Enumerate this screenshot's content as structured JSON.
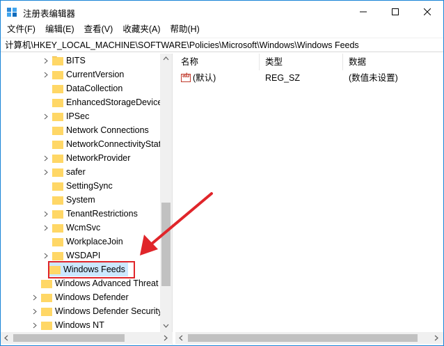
{
  "window": {
    "title": "注册表编辑器"
  },
  "menu": [
    {
      "label": "文件(F)"
    },
    {
      "label": "编辑(E)"
    },
    {
      "label": "查看(V)"
    },
    {
      "label": "收藏夹(A)"
    },
    {
      "label": "帮助(H)"
    }
  ],
  "address": {
    "path": "计算机\\HKEY_LOCAL_MACHINE\\SOFTWARE\\Policies\\Microsoft\\Windows\\Windows Feeds"
  },
  "tree": {
    "items": [
      {
        "label": "BITS",
        "expandable": true
      },
      {
        "label": "CurrentVersion",
        "expandable": true
      },
      {
        "label": "DataCollection",
        "expandable": false
      },
      {
        "label": "EnhancedStorageDevices",
        "expandable": false
      },
      {
        "label": "IPSec",
        "expandable": true
      },
      {
        "label": "Network Connections",
        "expandable": false
      },
      {
        "label": "NetworkConnectivityStatusIndicator",
        "expandable": false
      },
      {
        "label": "NetworkProvider",
        "expandable": true
      },
      {
        "label": "safer",
        "expandable": true
      },
      {
        "label": "SettingSync",
        "expandable": false
      },
      {
        "label": "System",
        "expandable": false
      },
      {
        "label": "TenantRestrictions",
        "expandable": true
      },
      {
        "label": "WcmSvc",
        "expandable": true
      },
      {
        "label": "WorkplaceJoin",
        "expandable": false
      },
      {
        "label": "WSDAPI",
        "expandable": true
      },
      {
        "label": "Windows Feeds",
        "expandable": false,
        "selected": true
      },
      {
        "label": "Windows Advanced Threat Protection",
        "expandable": false
      },
      {
        "label": "Windows Defender",
        "expandable": true
      },
      {
        "label": "Windows Defender Security Center",
        "expandable": true
      },
      {
        "label": "Windows NT",
        "expandable": true
      }
    ]
  },
  "values_table": {
    "headers": {
      "name": "名称",
      "type": "类型",
      "data": "数据"
    },
    "rows": [
      {
        "name": "(默认)",
        "type": "REG_SZ",
        "data": "(数值未设置)"
      }
    ]
  },
  "colors": {
    "folder": "#ffd766",
    "selection": "#cce8ff",
    "highlight_border": "#e0252a",
    "window_border": "#1883d7"
  }
}
